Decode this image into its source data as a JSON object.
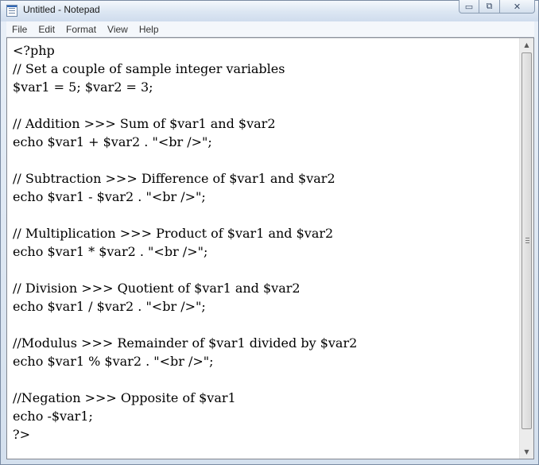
{
  "window": {
    "title": "Untitled - Notepad",
    "controls": {
      "minimize": "▭",
      "maximize": "⧉",
      "close": "✕"
    }
  },
  "menu": [
    "File",
    "Edit",
    "Format",
    "View",
    "Help"
  ],
  "editor": {
    "lines": [
      "<?php",
      "// Set a couple of sample integer variables",
      "$var1 = 5; $var2 = 3;",
      "",
      "// Addition >>> Sum of $var1 and $var2",
      "echo $var1 + $var2 . \"<br />\";",
      "",
      "// Subtraction >>> Difference of $var1 and $var2",
      "echo $var1 - $var2 . \"<br />\";",
      "",
      "// Multiplication >>> Product of $var1 and $var2",
      "echo $var1 * $var2 . \"<br />\";",
      "",
      "// Division >>> Quotient of $var1 and $var2",
      "echo $var1 / $var2 . \"<br />\";",
      "",
      "//Modulus >>> Remainder of $var1 divided by $var2",
      "echo $var1 % $var2 . \"<br />\";",
      "",
      "//Negation >>> Opposite of $var1",
      "echo -$var1;",
      "?>"
    ]
  },
  "scrollbar": {
    "up_arrow": "▲",
    "down_arrow": "▼"
  },
  "icons": {
    "app": "notepad-icon",
    "minimize": "minimize-icon",
    "maximize": "maximize-icon",
    "close": "close-icon"
  }
}
